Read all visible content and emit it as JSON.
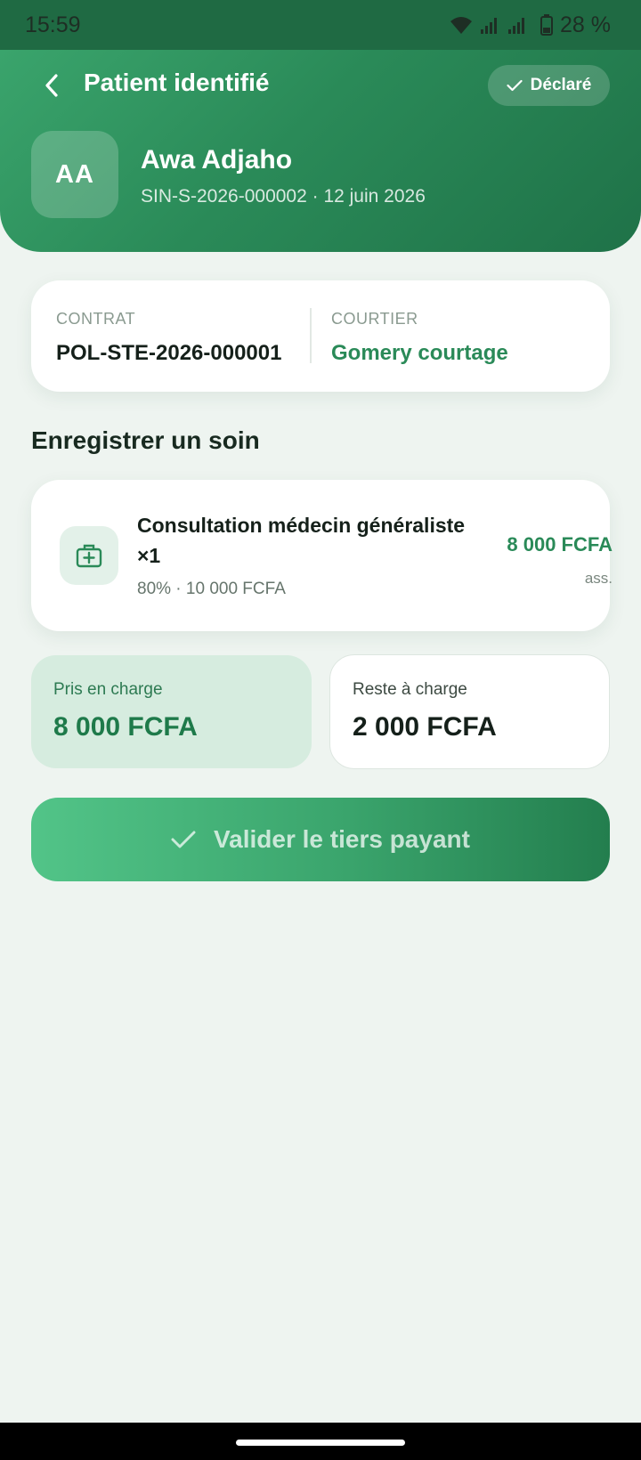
{
  "status_bar": {
    "time": "15:59",
    "battery": "28 %"
  },
  "header": {
    "title": "Patient identifié",
    "declared_label": "Déclaré",
    "colors": {
      "primary": "#2a8a58",
      "dark": "#1f7248"
    }
  },
  "patient": {
    "initials": "AA",
    "name": "Awa Adjaho",
    "meta": "SIN-S-2026-000002 · 12 juin 2026"
  },
  "contract": {
    "contract_label": "CONTRAT",
    "contract_value": "POL-STE-2026-000001",
    "broker_label": "COURTIER",
    "broker_value": "Gomery courtage"
  },
  "care_section": {
    "title": "Enregistrer un soin",
    "item": {
      "icon": "medical-kit-icon",
      "name": "Consultation médecin généraliste ×1",
      "detail": "80% · 10 000 FCFA",
      "amount": "8 000 FCFA",
      "amount_suffix": "ass."
    }
  },
  "summary": {
    "covered_label": "Pris en charge",
    "covered_value": "8 000 FCFA",
    "remaining_label": "Reste à charge",
    "remaining_value": "2 000 FCFA"
  },
  "actions": {
    "validate_label": "Valider le tiers payant"
  }
}
